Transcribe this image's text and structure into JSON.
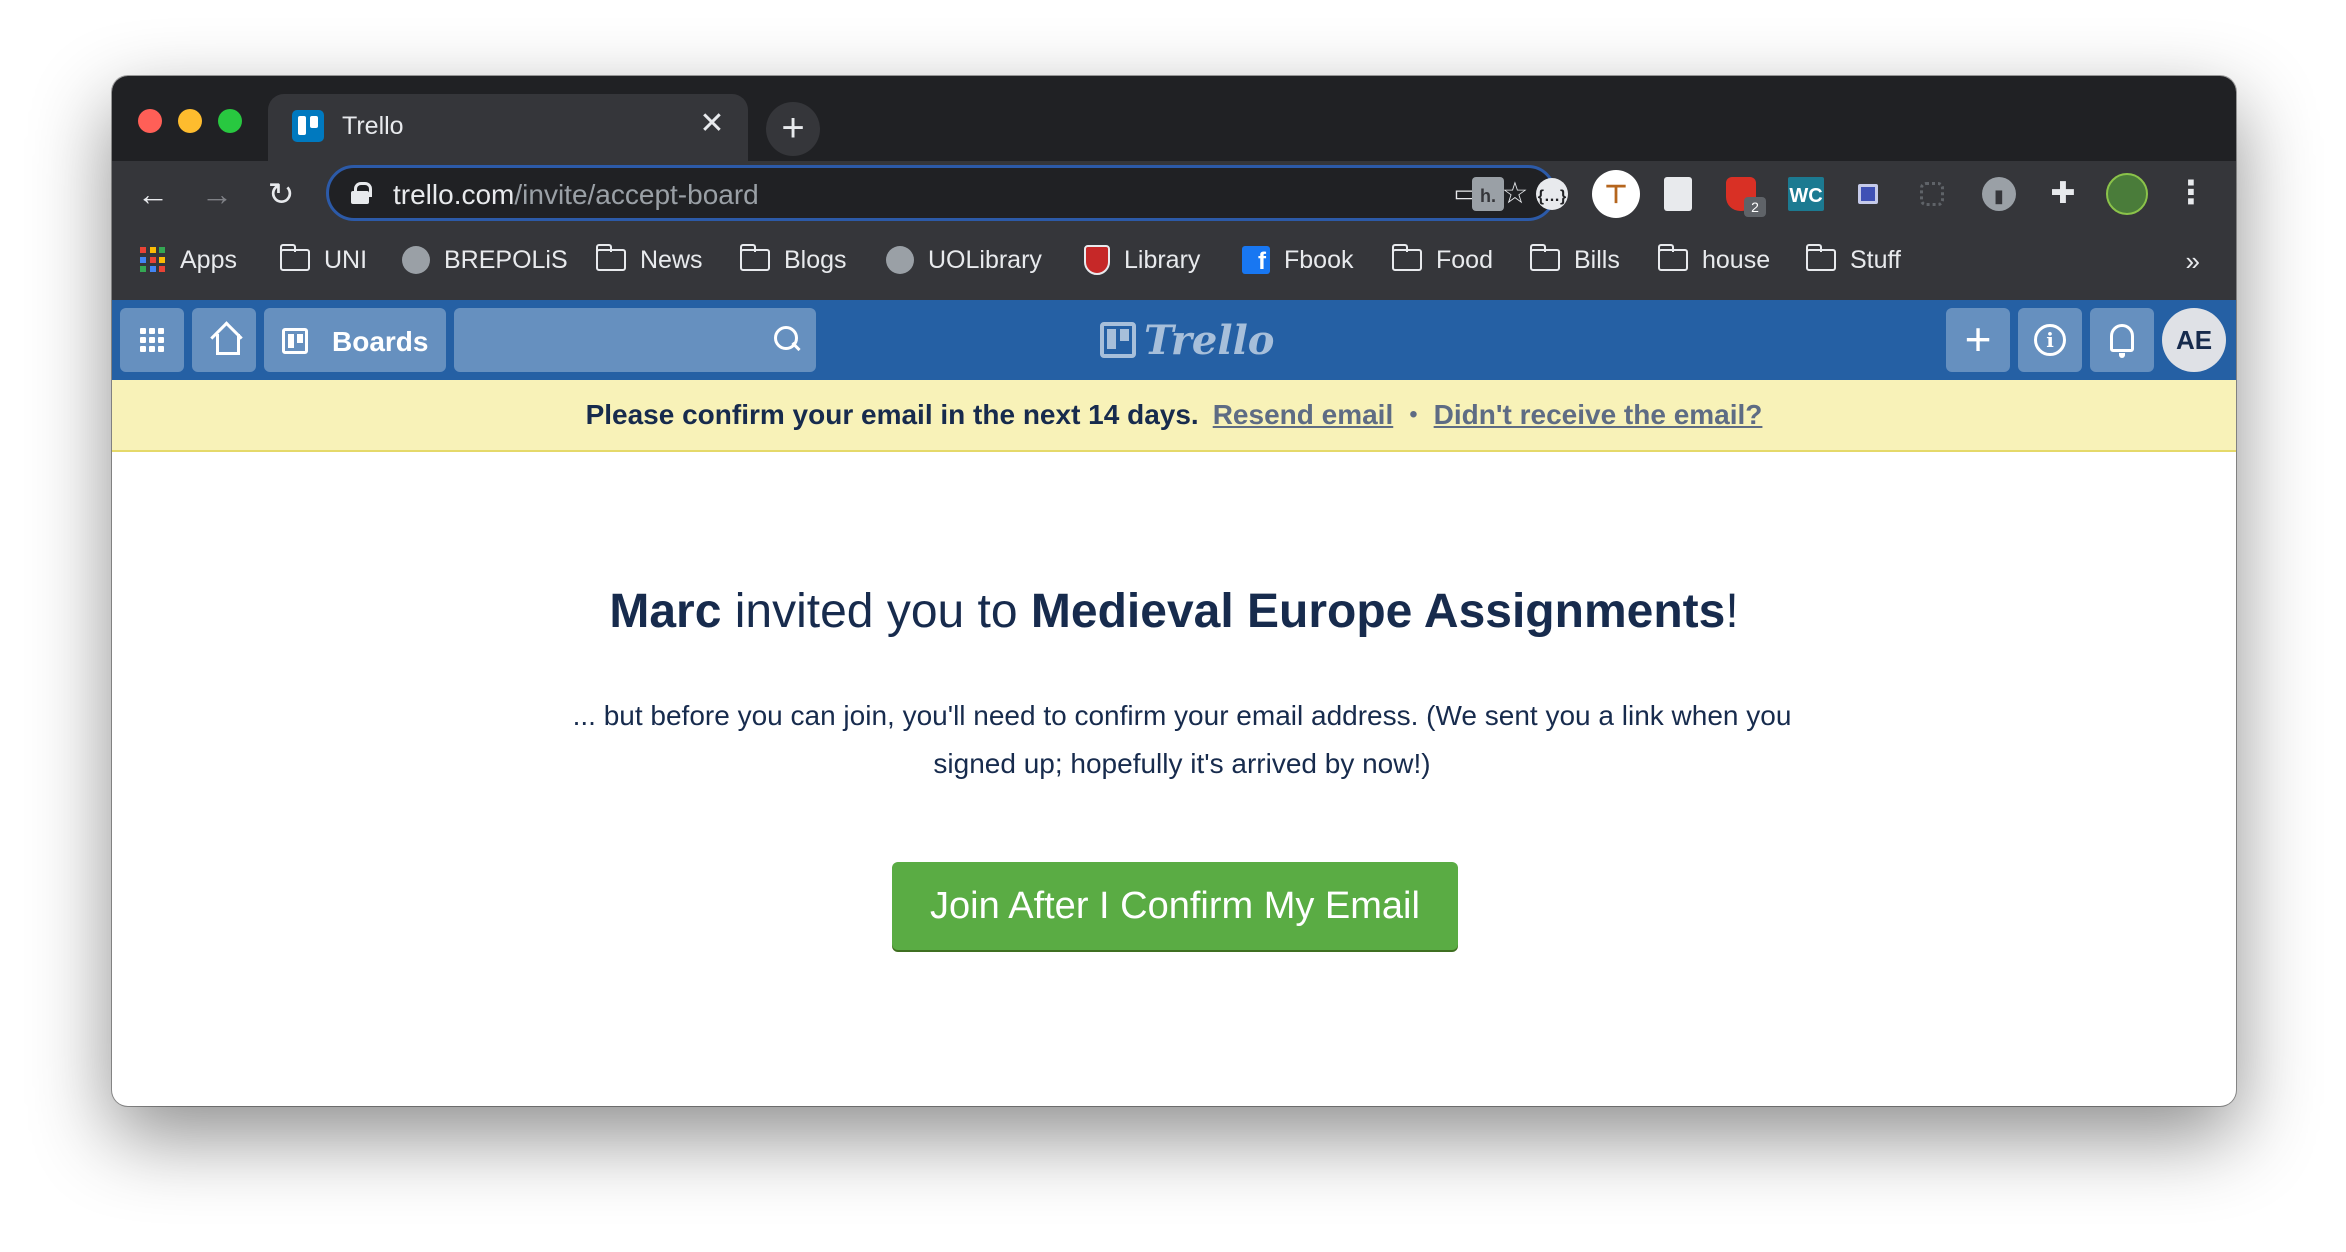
{
  "browser": {
    "tab_title": "Trello",
    "tab_close": "✕",
    "new_tab": "+",
    "url_host": "trello.com",
    "url_path": "/invite/accept-board",
    "extension_badge": "2",
    "ext_hypothesis": "h.",
    "ext_json": "{…}",
    "ext_wc": "WC",
    "bookmarks": [
      {
        "label": "Apps",
        "icon": "apps-grid-icon"
      },
      {
        "label": "UNI",
        "icon": "folder-icon"
      },
      {
        "label": "BREPOLiS",
        "icon": "globe-icon"
      },
      {
        "label": "News",
        "icon": "folder-icon"
      },
      {
        "label": "Blogs",
        "icon": "folder-icon"
      },
      {
        "label": "UOLibrary",
        "icon": "globe-icon"
      },
      {
        "label": "Library",
        "icon": "crest-icon"
      },
      {
        "label": "Fbook",
        "icon": "facebook-icon"
      },
      {
        "label": "Food",
        "icon": "folder-icon"
      },
      {
        "label": "Bills",
        "icon": "folder-icon"
      },
      {
        "label": "house",
        "icon": "folder-icon"
      },
      {
        "label": "Stuff",
        "icon": "folder-icon"
      }
    ],
    "bookmarks_overflow": "»"
  },
  "trello_header": {
    "boards_label": "Boards",
    "logo_text": "Trello",
    "avatar_initials": "AE",
    "create_label": "+",
    "info_label": "i",
    "brand_color": "#2560a4"
  },
  "banner": {
    "message": "Please confirm your email in the next 14 days.",
    "resend_link": "Resend email",
    "separator": "•",
    "not_received_link": "Didn't receive the email?"
  },
  "invite": {
    "inviter": "Marc",
    "middle": " invited you to ",
    "board_name": "Medieval Europe Assignments",
    "end": "!",
    "description": "... but before you can join, you'll need to confirm your email address. (We sent you a link when you signed up; hopefully it's arrived by now!)",
    "button_label": "Join After I Confirm My Email",
    "button_color": "#5aac44"
  }
}
